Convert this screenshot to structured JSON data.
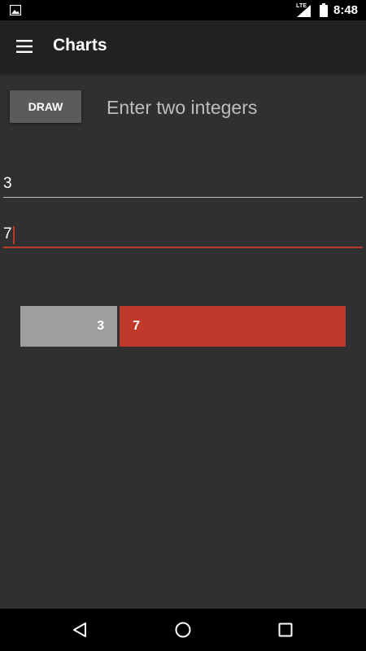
{
  "status_bar": {
    "network": "LTE",
    "time": "8:48",
    "icons": [
      "image-notification-icon",
      "signal-icon",
      "battery-icon"
    ]
  },
  "app_bar": {
    "title": "Charts",
    "menu_icon": "hamburger-menu-icon"
  },
  "main": {
    "draw_button_label": "DRAW",
    "hint": "Enter two integers",
    "input_1_value": "3",
    "input_2_value": "7"
  },
  "chart_data": {
    "type": "bar",
    "orientation": "horizontal-stacked",
    "categories": [
      "3",
      "7"
    ],
    "values": [
      3,
      7
    ],
    "colors": [
      "#9e9e9e",
      "#c0392b"
    ],
    "data_labels": [
      "3",
      "7"
    ]
  },
  "nav_bar": {
    "icons": [
      "back-icon",
      "home-icon",
      "recents-icon"
    ]
  },
  "colors": {
    "background": "#303030",
    "app_bar": "#212121",
    "accent": "#c0392b",
    "bar_neutral": "#9e9e9e",
    "button": "#5b5b5b"
  }
}
